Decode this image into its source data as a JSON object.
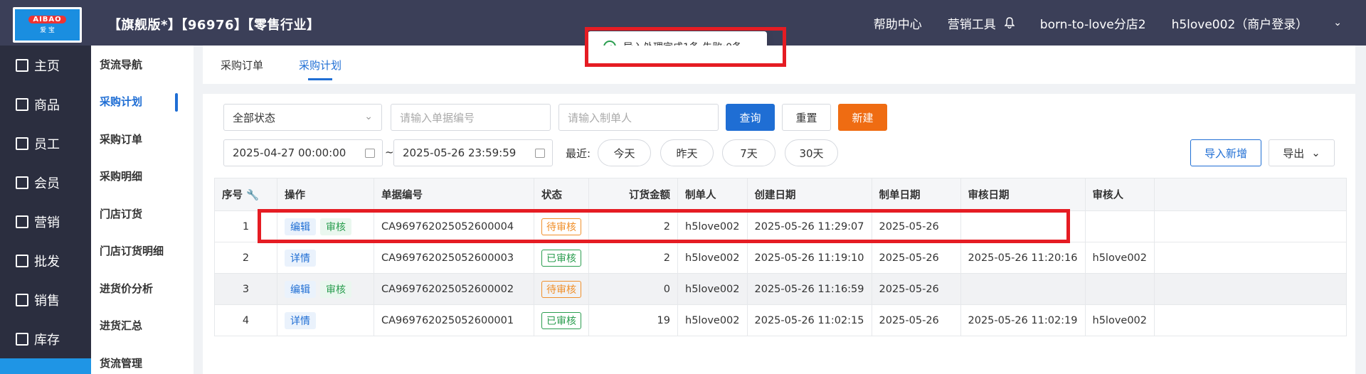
{
  "header": {
    "logo_top": "AIBAO",
    "logo_bottom": "爱 宝",
    "edition": "【旗舰版*】【96976】【零售行业】",
    "nav": [
      "帮助中心",
      "营销工具"
    ],
    "store": "born-to-love分店2",
    "user": "h5love002（商户登录）"
  },
  "leftnav": [
    {
      "label": "主页",
      "icon": "home-icon"
    },
    {
      "label": "商品",
      "icon": "goods-icon"
    },
    {
      "label": "员工",
      "icon": "staff-icon"
    },
    {
      "label": "会员",
      "icon": "member-icon"
    },
    {
      "label": "营销",
      "icon": "megaphone-icon"
    },
    {
      "label": "批发",
      "icon": "wholesale-icon"
    },
    {
      "label": "销售",
      "icon": "chart-icon"
    },
    {
      "label": "库存",
      "icon": "pie-icon"
    }
  ],
  "subnav": [
    "货流导航",
    "采购计划",
    "采购订单",
    "采购明细",
    "门店订货",
    "门店订货明细",
    "进货价分析",
    "进货汇总",
    "货流管理"
  ],
  "tabs": [
    "采购订单",
    "采购计划"
  ],
  "toast": "导入处理完成1条,失败:0条",
  "filters": {
    "status_value": "全部状态",
    "doc_no_placeholder": "请输入单据编号",
    "maker_placeholder": "请输入制单人",
    "query": "查询",
    "reset": "重置",
    "create": "新建",
    "date_start": "2025-04-27 00:00:00",
    "date_sep": "~",
    "date_end": "2025-05-26 23:59:59",
    "recent_label": "最近:",
    "recent": [
      "今天",
      "昨天",
      "7天",
      "30天"
    ],
    "import": "导入新增",
    "export": "导出"
  },
  "table": {
    "headers": [
      "序号",
      "操作",
      "单据编号",
      "状态",
      "订货金额",
      "制单人",
      "创建日期",
      "制单日期",
      "审核日期",
      "审核人"
    ],
    "rows": [
      {
        "no": "1",
        "ops": [
          "编辑",
          "审核"
        ],
        "doc": "CA969762025052600004",
        "status": "待审核",
        "status_type": "pending",
        "amount": "2",
        "maker": "h5love002",
        "created": "2025-05-26 11:29:07",
        "made": "2025-05-26",
        "audited": "",
        "auditor": ""
      },
      {
        "no": "2",
        "ops": [
          "详情"
        ],
        "doc": "CA969762025052600003",
        "status": "已审核",
        "status_type": "done",
        "amount": "2",
        "maker": "h5love002",
        "created": "2025-05-26 11:19:10",
        "made": "2025-05-26",
        "audited": "2025-05-26 11:20:16",
        "auditor": "h5love002"
      },
      {
        "no": "3",
        "ops": [
          "编辑",
          "审核"
        ],
        "doc": "CA969762025052600002",
        "status": "待审核",
        "status_type": "pending",
        "amount": "0",
        "maker": "h5love002",
        "created": "2025-05-26 11:16:59",
        "made": "2025-05-26",
        "audited": "",
        "auditor": ""
      },
      {
        "no": "4",
        "ops": [
          "详情"
        ],
        "doc": "CA969762025052600001",
        "status": "已审核",
        "status_type": "done",
        "amount": "19",
        "maker": "h5love002",
        "created": "2025-05-26 11:02:15",
        "made": "2025-05-26",
        "audited": "2025-05-26 11:02:19",
        "auditor": "h5love002"
      }
    ]
  }
}
